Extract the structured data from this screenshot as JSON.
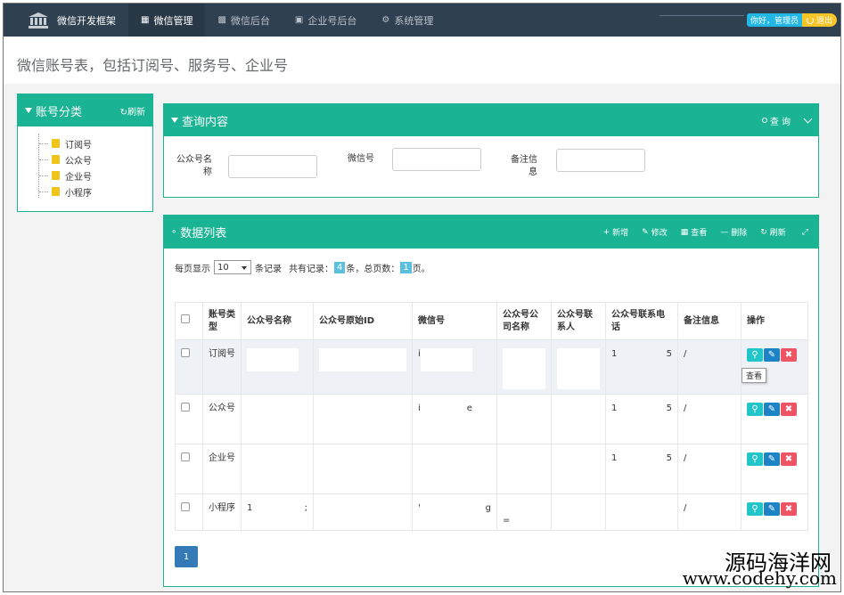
{
  "topbar": {
    "brand": "微信开发框架",
    "nav": [
      {
        "label": "微信管理",
        "icon": "grid-icon"
      },
      {
        "label": "微信后台",
        "icon": "apps-icon"
      },
      {
        "label": "企业号后台",
        "icon": "qrcode-icon"
      },
      {
        "label": "系统管理",
        "icon": "gear-icon"
      }
    ],
    "welcome": "你好，管理员",
    "logout": "退出"
  },
  "page_title": "微信账号表，包括订阅号、服务号、企业号",
  "left_panel": {
    "title": "账号分类",
    "refresh": "刷新",
    "items": [
      "订阅号",
      "公众号",
      "企业号",
      "小程序"
    ]
  },
  "query_panel": {
    "title": "查询内容",
    "search": "查 询",
    "fields": [
      {
        "label": "公众号名称"
      },
      {
        "label": "微信号"
      },
      {
        "label": "备注信息"
      }
    ]
  },
  "data_panel": {
    "title": "数据列表",
    "actions": [
      {
        "label": "新增",
        "icon": "plus-icon"
      },
      {
        "label": "修改",
        "icon": "pencil-icon"
      },
      {
        "label": "查看",
        "icon": "table-icon"
      },
      {
        "label": "删除",
        "icon": "minus-icon"
      },
      {
        "label": "刷新",
        "icon": "refresh-icon"
      },
      {
        "label": "",
        "icon": "expand-icon"
      }
    ],
    "pager": {
      "per_page_prefix": "每页显示",
      "per_page_value": "10",
      "per_page_suffix": "条记录",
      "total_prefix": "共有记录：",
      "total_records": "4",
      "total_mid": "条，总页数：",
      "total_pages": "1",
      "total_suffix": "页。"
    },
    "columns": [
      "账号类型",
      "公众号名称",
      "公众号原始ID",
      "微信号",
      "公众号公司名称",
      "公众号联系人",
      "公众号联系电话",
      "备注信息",
      "操作"
    ],
    "rows": [
      {
        "type": "订阅号",
        "wechat": "i",
        "phone": "1",
        "phone_end": "5",
        "note": "/"
      },
      {
        "type": "公众号",
        "wechat": "i",
        "wechat_end": "e",
        "phone": "1",
        "phone_end": "5",
        "note": "/"
      },
      {
        "type": "企业号",
        "phone": "1",
        "phone_end": "5",
        "note": "/"
      },
      {
        "type": "小程序",
        "name": "1",
        "name_end": ";",
        "wechat": "'",
        "wechat_end": "g",
        "company": "=",
        "note": "/"
      }
    ],
    "row_button_icons": [
      "search-icon",
      "pencil-icon",
      "close-icon"
    ],
    "tooltip": "查看",
    "current_page": "1"
  },
  "watermark": {
    "line1": "源码海洋网",
    "line2": "www.codehy.com"
  },
  "colors": {
    "nav_bg": "#2f4050",
    "primary": "#1ab394",
    "view": "#23c6c8",
    "edit": "#1c84c6",
    "delete": "#ed5565"
  }
}
